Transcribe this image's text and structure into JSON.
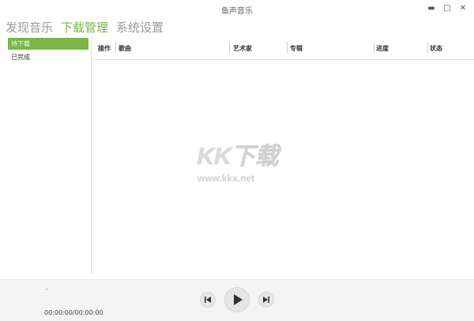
{
  "app": {
    "title": "鱼声音乐"
  },
  "window_controls": {
    "minimize": "▬",
    "maximize": "□",
    "close": "✕"
  },
  "nav": {
    "tabs": [
      {
        "label": "发现音乐",
        "active": false
      },
      {
        "label": "下载管理",
        "active": true
      },
      {
        "label": "系统设置",
        "active": false
      }
    ]
  },
  "sidebar": {
    "items": [
      {
        "label": "待下载",
        "active": true
      },
      {
        "label": "已完成",
        "active": false
      }
    ]
  },
  "table": {
    "columns": [
      "操作",
      "歌曲",
      "艺术家",
      "专辑",
      "进度",
      "状态"
    ]
  },
  "watermark": {
    "text": "KK下载",
    "url": "www.kkx.net"
  },
  "player": {
    "track_title": "-",
    "time": "00:00:00/00:00:00"
  },
  "colors": {
    "accent": "#7ab648",
    "inactive_tab": "#999999"
  }
}
